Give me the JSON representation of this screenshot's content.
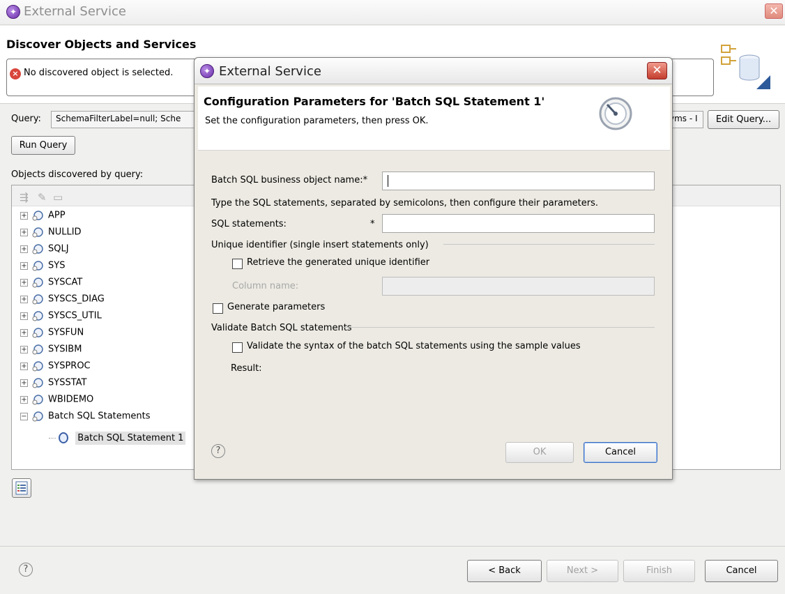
{
  "window": {
    "title": "External Service",
    "close_glyph": "✕"
  },
  "page": {
    "heading": "Discover Objects and Services",
    "error_message": "No discovered object is selected."
  },
  "query": {
    "label": "Query:",
    "value": "SchemaFilterLabel=null; Sche",
    "value_tail": "yms - I",
    "edit_button": "Edit Query...",
    "run_button": "Run Query"
  },
  "objects": {
    "label": "Objects discovered by query:",
    "items": [
      {
        "label": "APP",
        "expander": "+"
      },
      {
        "label": "NULLID",
        "expander": "+"
      },
      {
        "label": "SQLJ",
        "expander": "+"
      },
      {
        "label": "SYS",
        "expander": "+"
      },
      {
        "label": "SYSCAT",
        "expander": "+"
      },
      {
        "label": "SYSCS_DIAG",
        "expander": "+"
      },
      {
        "label": "SYSCS_UTIL",
        "expander": "+"
      },
      {
        "label": "SYSFUN",
        "expander": "+"
      },
      {
        "label": "SYSIBM",
        "expander": "+"
      },
      {
        "label": "SYSPROC",
        "expander": "+"
      },
      {
        "label": "SYSSTAT",
        "expander": "+"
      },
      {
        "label": "WBIDEMO",
        "expander": "+"
      },
      {
        "label": "Batch SQL Statements",
        "expander": "−"
      }
    ],
    "child": "Batch SQL Statement 1"
  },
  "wizard_buttons": {
    "help": "?",
    "back": "< Back",
    "next": "Next >",
    "finish": "Finish",
    "cancel": "Cancel"
  },
  "dialog": {
    "title": "External Service",
    "close_glyph": "✕",
    "heading": "Configuration Parameters for 'Batch SQL Statement 1'",
    "subheading": "Set the configuration parameters, then press OK.",
    "bo_name_label": "Batch SQL business object name:*",
    "bo_name_value": "",
    "sql_hint": "Type the SQL statements, separated by semicolons, then configure their parameters.",
    "sql_label": "SQL statements:",
    "required_mark": "*",
    "sql_value": "",
    "uid_group": "Unique identifier (single insert statements only)",
    "retrieve_label": "Retrieve the generated unique identifier",
    "column_label": "Column name:",
    "column_value": "",
    "generate_label": "Generate parameters",
    "validate_group": "Validate Batch SQL statements",
    "validate_label": "Validate the syntax of the batch SQL statements using the sample values",
    "result_label": "Result:",
    "help": "?",
    "ok": "OK",
    "cancel": "Cancel"
  },
  "colors": {
    "accent": "#6a2ea8",
    "error": "#d9463b",
    "close": "#c43d2d"
  }
}
